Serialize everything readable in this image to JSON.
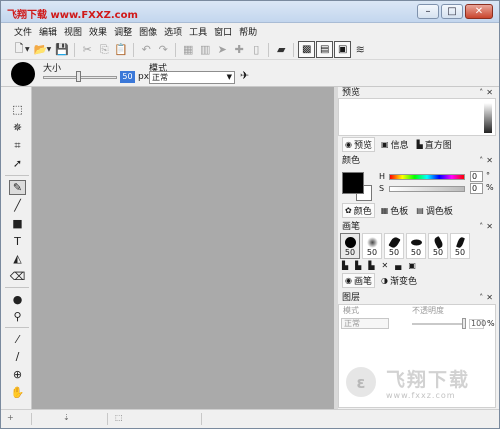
{
  "window": {
    "title": "飞翔下载 www.FXXZ.com",
    "buttons": {
      "minimize": "–",
      "maximize": "□",
      "close": "✕"
    }
  },
  "menu": [
    "文件",
    "编辑",
    "视图",
    "效果",
    "调整",
    "图像",
    "选项",
    "工具",
    "窗口",
    "帮助"
  ],
  "options": {
    "size_label": "大小",
    "size_value": "50",
    "size_unit": "px",
    "mode_label": "模式",
    "mode_value": "正常"
  },
  "panels": {
    "preview": {
      "title": "预览",
      "tabs": [
        "预览",
        "信息",
        "直方图"
      ]
    },
    "color": {
      "title": "颜色",
      "h_label": "H",
      "s_label": "S",
      "h_value": "0",
      "s_value": "0",
      "h_unit": "°",
      "s_unit": "%",
      "tabs": [
        "颜色",
        "色板",
        "调色板"
      ],
      "foreground": "#000000",
      "background": "#ffffff"
    },
    "brushes": {
      "title": "画笔",
      "sizes": [
        "50",
        "50",
        "50",
        "50",
        "50",
        "50"
      ],
      "tabs": [
        "画笔",
        "渐变色"
      ]
    },
    "layers": {
      "title": "图层",
      "mode_label": "模式",
      "opacity_label": "不透明度",
      "mode_value": "正常",
      "opacity_value": "100",
      "opacity_unit": "%"
    }
  },
  "watermark": {
    "brand": "飞翔下载",
    "url": "www.fxxz.com"
  },
  "colors": {
    "title_text": "#d01818",
    "canvas": "#aaaaaa",
    "size_highlight": "#3b78d8"
  }
}
